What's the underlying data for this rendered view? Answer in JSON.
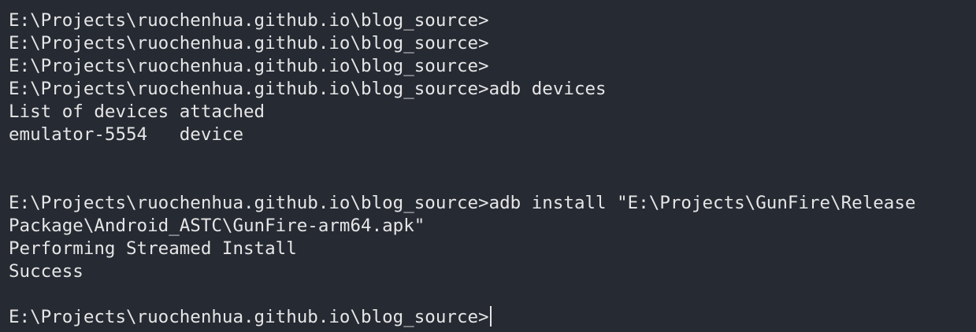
{
  "terminal": {
    "lines": [
      "E:\\Projects\\ruochenhua.github.io\\blog_source>",
      "E:\\Projects\\ruochenhua.github.io\\blog_source>",
      "E:\\Projects\\ruochenhua.github.io\\blog_source>",
      "E:\\Projects\\ruochenhua.github.io\\blog_source>adb devices",
      "List of devices attached",
      "emulator-5554   device",
      "",
      "",
      "E:\\Projects\\ruochenhua.github.io\\blog_source>adb install \"E:\\Projects\\GunFire\\Release",
      "Package\\Android_ASTC\\GunFire-arm64.apk\"",
      "Performing Streamed Install",
      "Success",
      "",
      "E:\\Projects\\ruochenhua.github.io\\blog_source>"
    ],
    "colors": {
      "background": "#262a33",
      "foreground": "#e6e6e6",
      "cursor": "#e6e6e6"
    }
  }
}
